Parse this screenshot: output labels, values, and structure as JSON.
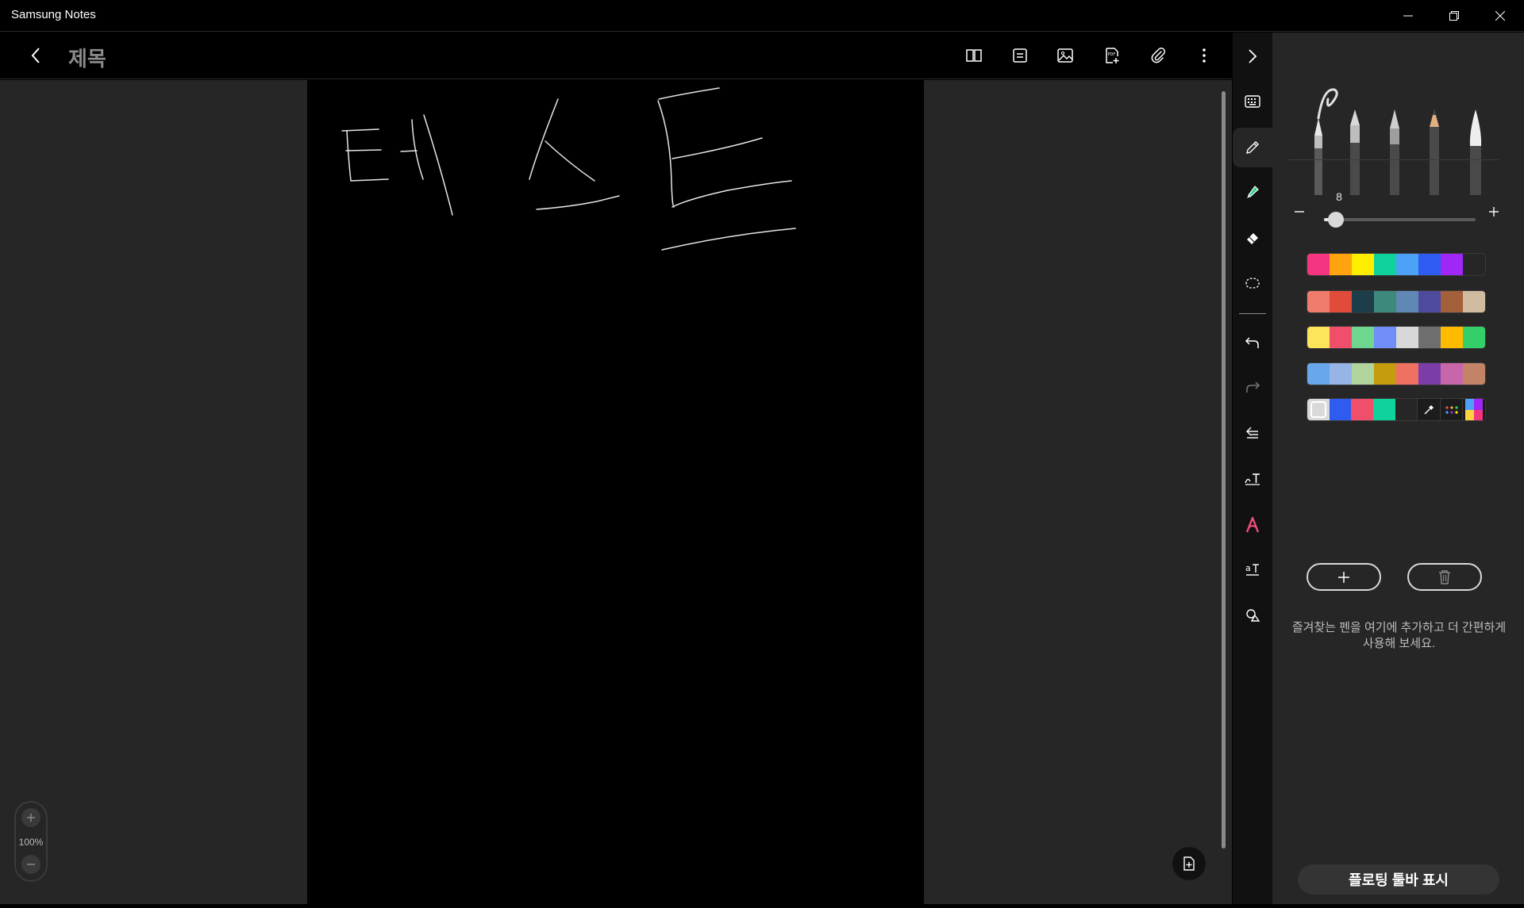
{
  "window": {
    "title": "Samsung Notes",
    "controls": [
      "minimize-icon",
      "restore-icon",
      "close-icon"
    ]
  },
  "toolbar": {
    "back_icon": "chevron-left-icon",
    "note_title": "제목",
    "icons": [
      "book-view-icon",
      "text-note-icon",
      "image-icon",
      "pdf-add-icon",
      "attachment-icon",
      "more-vertical-icon"
    ]
  },
  "canvas": {
    "background": "#000000",
    "stroke_color": "#e6e6e6",
    "handwriting": "테스트"
  },
  "zoom": {
    "level": "100%",
    "plus_icon": "plus-icon",
    "minus_icon": "minus-icon"
  },
  "sidestrip": {
    "collapse_icon": "chevron-right-icon",
    "tools": [
      "keyboard-icon",
      "pen-icon",
      "highlighter-icon",
      "eraser-icon",
      "lasso-icon",
      "undo-icon",
      "redo-icon",
      "text-align-icon",
      "handwriting-text-icon",
      "shape-a-icon",
      "text-size-icon",
      "shapes-icon"
    ],
    "active_tool": "pen-icon"
  },
  "pen_panel": {
    "pens": [
      "fountain-pen",
      "calligraphy-pen",
      "ballpoint-pen",
      "pencil",
      "brush"
    ],
    "selected_pen": "fountain-pen",
    "size": "8",
    "size_fraction": 0.08,
    "palettes": [
      [
        "#f5357f",
        "#ffa40f",
        "#ffee00",
        "#0ed39a",
        "#4ba2f7",
        "#2e5bf0",
        "#a027f5",
        "#262626"
      ],
      [
        "#f07c6b",
        "#e04b3a",
        "#1e3d4a",
        "#3d8a7d",
        "#5f88b5",
        "#4e4b9e",
        "#a3603a",
        "#d1bba1"
      ],
      [
        "#fde55b",
        "#f04f6c",
        "#6fd690",
        "#6f8ef7",
        "#d8d8d8",
        "#6e6e6e",
        "#ffbb00",
        "#35cf6a"
      ],
      [
        "#68a7eb",
        "#96b4e6",
        "#b1d49d",
        "#c49c0c",
        "#ef7162",
        "#7b3da8",
        "#c767aa",
        "#c28366"
      ],
      [
        "#d9d9d9",
        "#2e5bf0",
        "#f04f6c",
        "#0ed39a",
        "#262626"
      ]
    ],
    "selected_color": "#d9d9d9",
    "extra_icons": [
      "eyedropper-icon",
      "color-dots-icon",
      "color-spectrum-icon"
    ],
    "add_icon": "plus-icon",
    "delete_icon": "trash-icon",
    "hint": "즐겨찾는 펜을 여기에 추가하고 더 간편하게 사용해 보세요.",
    "floating_toolbar_label": "플로팅 툴바 표시"
  },
  "addpage_icon": "add-page-icon"
}
